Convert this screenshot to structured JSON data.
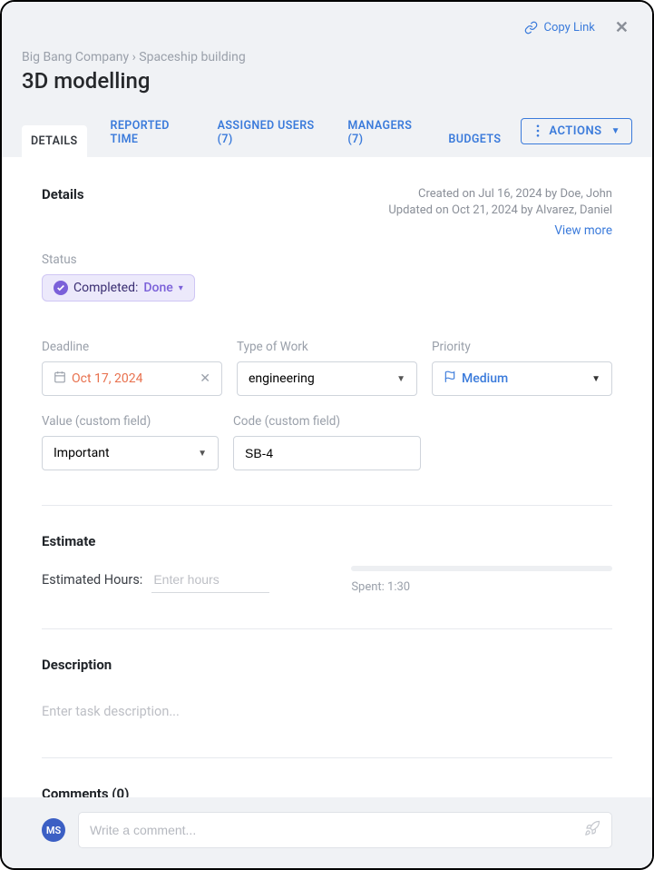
{
  "topbar": {
    "copy_link": "Copy Link"
  },
  "breadcrumb": {
    "company": "Big Bang Company",
    "sep": "›",
    "project": "Spaceship building"
  },
  "title": "3D modelling",
  "tabs": {
    "details": "DETAILS",
    "reported": "REPORTED TIME",
    "assigned": "ASSIGNED USERS (7)",
    "managers": "MANAGERS (7)",
    "budgets": "BUDGETS"
  },
  "actions_label": "ACTIONS",
  "details": {
    "heading": "Details",
    "created": "Created on Jul 16, 2024 by Doe, John",
    "updated": "Updated on Oct 21, 2024 by Alvarez, Daniel",
    "view_more": "View more",
    "status_label": "Status",
    "status_completed": "Completed:",
    "status_value": "Done",
    "deadline_label": "Deadline",
    "deadline_value": "Oct 17, 2024",
    "type_label": "Type of Work",
    "type_value": "engineering",
    "priority_label": "Priority",
    "priority_value": "Medium",
    "value_label": "Value (custom field)",
    "value_value": "Important",
    "code_label": "Code (custom field)",
    "code_value": "SB-4"
  },
  "estimate": {
    "heading": "Estimate",
    "hours_label": "Estimated Hours:",
    "hours_placeholder": "Enter hours",
    "spent": "Spent: 1:30"
  },
  "description": {
    "heading": "Description",
    "placeholder": "Enter task description..."
  },
  "comments": {
    "heading": "Comments (0)",
    "avatar": "MS",
    "placeholder": "Write a comment..."
  }
}
